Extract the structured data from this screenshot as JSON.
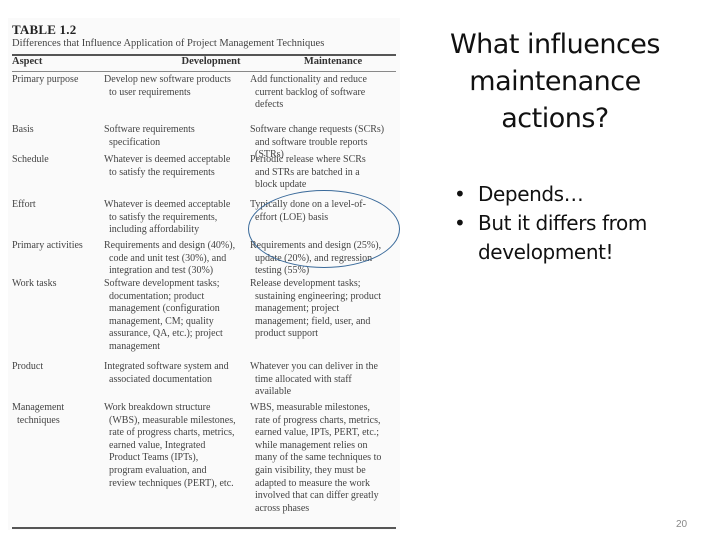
{
  "slide": {
    "title_lines": [
      "What influences",
      "maintenance",
      "actions?"
    ],
    "bullets": [
      {
        "lines": [
          "Depends…"
        ]
      },
      {
        "lines": [
          "But it differs from",
          "development!"
        ]
      }
    ],
    "page_number": "20",
    "annotation": {
      "type": "ellipse",
      "target": "Effort / Maintenance cell",
      "color": "#3a6a9a"
    }
  },
  "table": {
    "label": "TABLE 1.2",
    "caption": "Differences that Influence Application of Project Management Techniques",
    "headers": [
      "Aspect",
      "Development",
      "Maintenance"
    ],
    "rows": [
      {
        "aspect": [
          "Primary purpose"
        ],
        "development": [
          "Develop new software products",
          "to user requirements"
        ],
        "maintenance": [
          "Add functionality and reduce",
          "current backlog of software",
          "defects"
        ]
      },
      {
        "aspect": [
          "Basis"
        ],
        "development": [
          "Software requirements",
          "specification"
        ],
        "maintenance": [
          "Software change requests (SCRs)",
          "and software trouble reports",
          "(STRs)"
        ]
      },
      {
        "aspect": [
          "Schedule"
        ],
        "development": [
          "Whatever is deemed acceptable",
          "to satisfy the requirements"
        ],
        "maintenance": [
          "Periodic release where SCRs",
          "and STRs are batched in a",
          "block update"
        ]
      },
      {
        "aspect": [
          "Effort"
        ],
        "development": [
          "Whatever is deemed acceptable",
          "to satisfy the requirements,",
          "including affordability"
        ],
        "maintenance": [
          "Typically done on a level-of-",
          "effort (LOE) basis"
        ]
      },
      {
        "aspect": [
          "Primary activities"
        ],
        "development": [
          "Requirements and design (40%),",
          "code and unit test (30%), and",
          "integration and test (30%)"
        ],
        "maintenance": [
          "Requirements and design (25%),",
          "update (20%), and regression",
          "testing (55%)"
        ]
      },
      {
        "aspect": [
          "Work tasks"
        ],
        "development": [
          "Software development tasks;",
          "documentation; product",
          "management (configuration",
          "management, CM; quality",
          "assurance, QA, etc.); project",
          "management"
        ],
        "maintenance": [
          "Release development tasks;",
          "sustaining engineering; product",
          "management; project",
          "management; field, user, and",
          "product support"
        ]
      },
      {
        "aspect": [
          "Product"
        ],
        "development": [
          "Integrated software system and",
          "associated documentation"
        ],
        "maintenance": [
          "Whatever you can deliver in the",
          "time allocated with staff",
          "available"
        ]
      },
      {
        "aspect": [
          "Management",
          "techniques"
        ],
        "development": [
          "Work breakdown structure",
          "(WBS), measurable milestones,",
          "rate of progress charts, metrics,",
          "earned value, Integrated",
          "Product Teams (IPTs),",
          "program evaluation, and",
          "review techniques (PERT), etc."
        ],
        "maintenance": [
          "WBS, measurable milestones,",
          "rate of progress charts, metrics,",
          "earned value, IPTs, PERT, etc.;",
          "while management relies on",
          "many of the same techniques to",
          "gain visibility, they must be",
          "adapted to measure the work",
          "involved that can differ greatly",
          "across phases"
        ]
      }
    ]
  }
}
